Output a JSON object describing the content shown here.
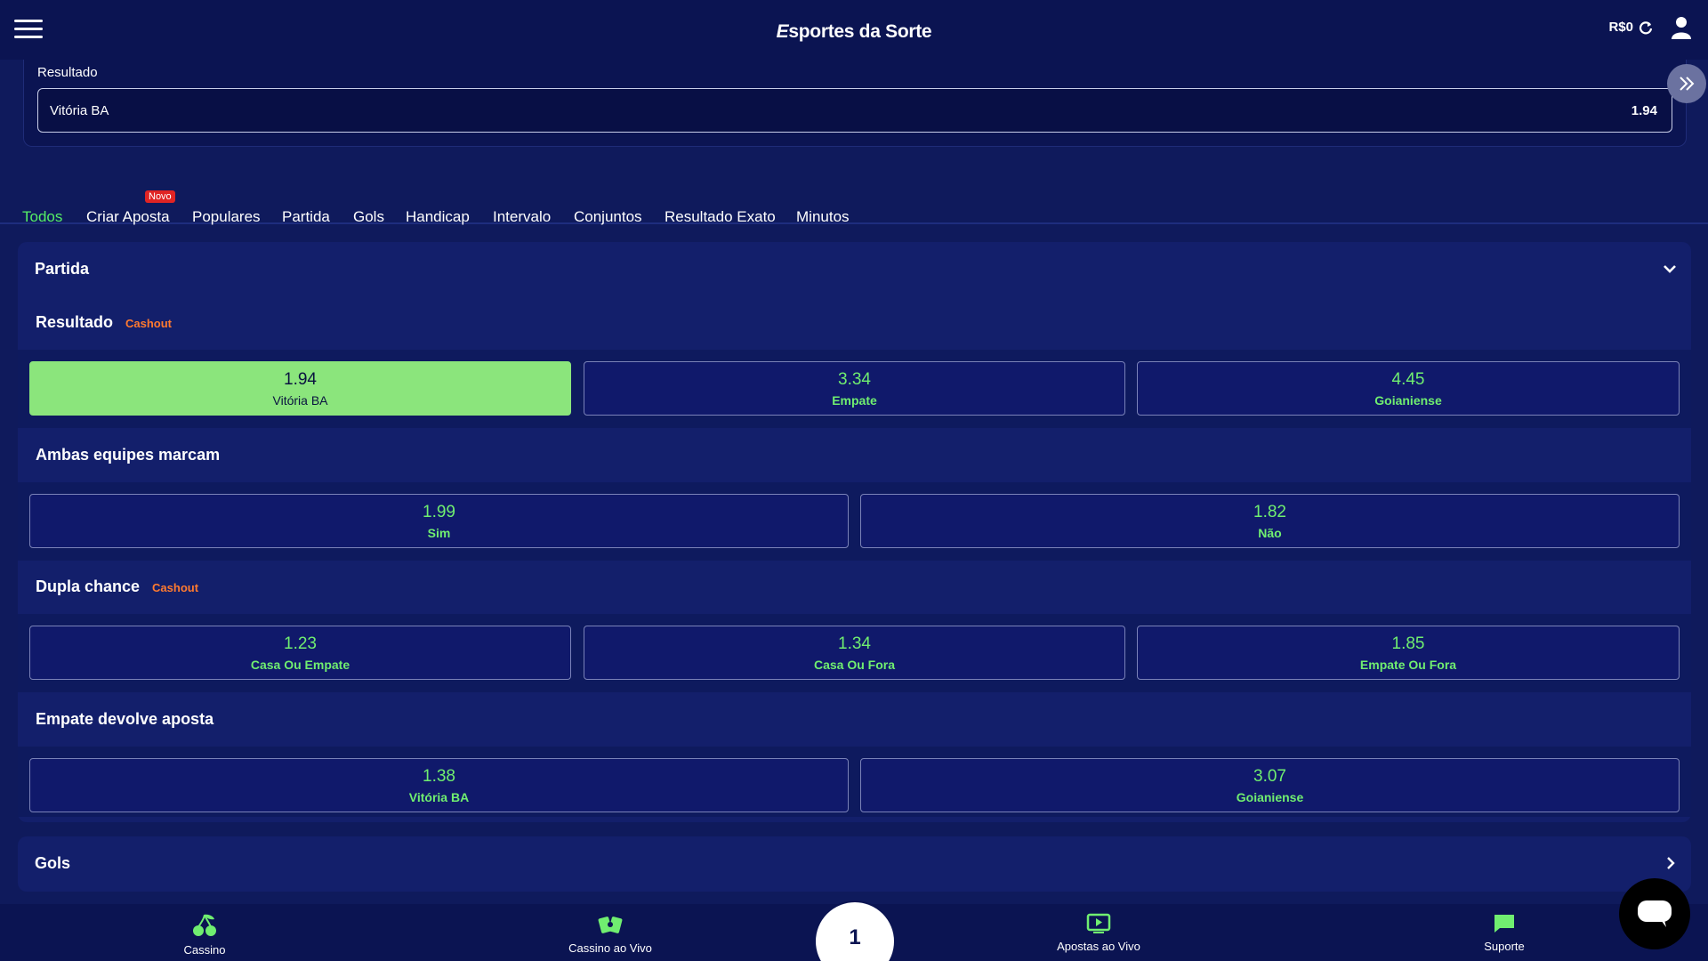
{
  "header": {
    "logo_prefix": "E",
    "logo_text": "sportes da Sorte",
    "balance": "R$0"
  },
  "slip": {
    "label": "Resultado",
    "team": "Vitória BA",
    "odd": "1.94"
  },
  "tabs": [
    {
      "label": "Todos"
    },
    {
      "label": "Criar Aposta"
    },
    {
      "label": "Populares"
    },
    {
      "label": "Partida"
    },
    {
      "label": "Gols"
    },
    {
      "label": "Handicap"
    },
    {
      "label": "Intervalo"
    },
    {
      "label": "Conjuntos"
    },
    {
      "label": "Resultado Exato"
    },
    {
      "label": "Minutos"
    }
  ],
  "badge_new": "Novo",
  "panel": {
    "title": "Partida",
    "markets": [
      {
        "title": "Resultado",
        "cashout": "Cashout",
        "odds": [
          {
            "value": "1.94",
            "label": "Vitória BA"
          },
          {
            "value": "3.34",
            "label": "Empate"
          },
          {
            "value": "4.45",
            "label": "Goianiense"
          }
        ]
      },
      {
        "title": "Ambas equipes marcam",
        "odds": [
          {
            "value": "1.99",
            "label": "Sim"
          },
          {
            "value": "1.82",
            "label": "Não"
          }
        ]
      },
      {
        "title": "Dupla chance",
        "cashout": "Cashout",
        "odds": [
          {
            "value": "1.23",
            "label": "Casa Ou Empate"
          },
          {
            "value": "1.34",
            "label": "Casa Ou Fora"
          },
          {
            "value": "1.85",
            "label": "Empate Ou Fora"
          }
        ]
      },
      {
        "title": "Empate devolve aposta",
        "odds": [
          {
            "value": "1.38",
            "label": "Vitória BA"
          },
          {
            "value": "3.07",
            "label": "Goianiense"
          }
        ]
      }
    ]
  },
  "gols": {
    "title": "Gols"
  },
  "bottom_nav": {
    "items": [
      {
        "label": "Cassino",
        "icon": "cherry-icon"
      },
      {
        "label": "Cassino ao Vivo",
        "icon": "cards-icon"
      },
      {
        "label": "Apostas ao Vivo",
        "icon": "live-tv-icon"
      },
      {
        "label": "Suporte",
        "icon": "chat-bubble-icon"
      }
    ],
    "betslip_count": "1"
  },
  "colors": {
    "background": "#0f1a5c",
    "accent_green": "#70ee70",
    "selected_green": "#8be57c",
    "cashout_orange": "#ff7a2f",
    "badge_red": "#e02424"
  }
}
